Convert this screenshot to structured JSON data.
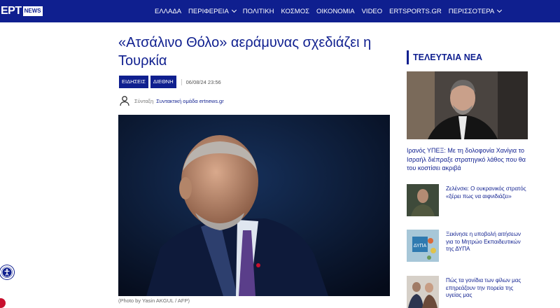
{
  "brand": {
    "logo_text": "ΕΡΤ",
    "logo_badge": "NEWS"
  },
  "nav": {
    "items": [
      {
        "label": "ΕΛΛΑΔΑ",
        "has_dropdown": false
      },
      {
        "label": "ΠΕΡΙΦΕΡΕΙΑ",
        "has_dropdown": true
      },
      {
        "label": "ΠΟΛΙΤΙΚΗ",
        "has_dropdown": false
      },
      {
        "label": "ΚΟΣΜΟΣ",
        "has_dropdown": false
      },
      {
        "label": "ΟΙΚΟΝΟΜΙΑ",
        "has_dropdown": false
      },
      {
        "label": "VIDEO",
        "has_dropdown": false
      },
      {
        "label": "ERTSPORTS.GR",
        "has_dropdown": false
      },
      {
        "label": "ΠΕΡΙΣΣΟΤΕΡΑ",
        "has_dropdown": true
      }
    ]
  },
  "article": {
    "title": "«Ατσάλινο Θόλο» αεράμυνας σχεδιάζει η Τουρκία",
    "tags": [
      "ΕΙΔΗΣΕΙΣ",
      "ΔΙΕΘΝΗ"
    ],
    "datetime": "06/08/24 23:56",
    "author_label": "Σύνταξη",
    "author_name": "Συντακτική ομάδα ertnews.gr",
    "image_caption": "(Photo by Yasin AKGUL / AFP)"
  },
  "sidebar": {
    "heading": "ΤΕΛΕΥΤΑΙΑ ΝΕΑ",
    "featured": {
      "title": "Ιρανός ΥΠΕΞ: Με τη δολοφονία Χανίγια το Ισραήλ διέπραξε στρατηγικό λάθος που θα του κοστίσει ακριβά"
    },
    "items": [
      {
        "title": "Ζελένσκι: Ο ουκρανικός στρατός «ξέρει πως να αιφνιδιάζει»"
      },
      {
        "title": "Ξεκίνησε η υποβολή αιτήσεων για το Μητρώο Εκπαιδευτικών της ΔΥΠΑ",
        "thumb_text": "ΔΥΠΑ"
      },
      {
        "title": "Πώς τα γονίδια των φίλων μας επηρεάζουν την πορεία της υγείας μας"
      }
    ]
  },
  "colors": {
    "brand_blue": "#0f1f8f",
    "accent_red": "#c8102e"
  }
}
